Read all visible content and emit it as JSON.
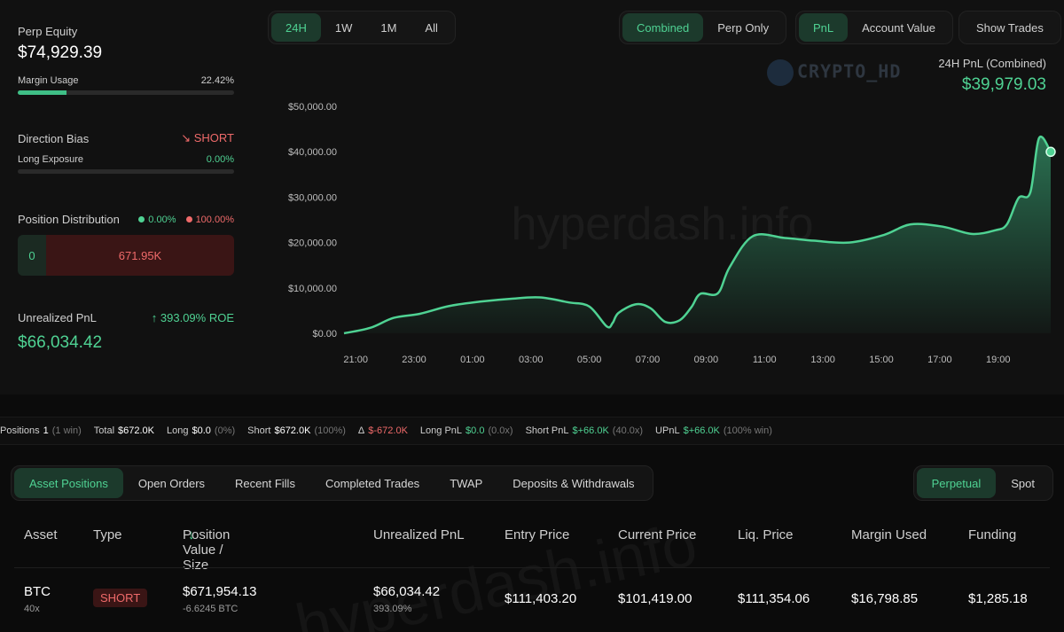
{
  "left": {
    "perp_equity": {
      "label": "Perp Equity",
      "value": "$74,929.39"
    },
    "margin_usage": {
      "label": "Margin Usage",
      "value": "22.42%",
      "fraction": 0.2242
    },
    "direction_bias": {
      "label": "Direction Bias",
      "value": "SHORT"
    },
    "long_exposure": {
      "label": "Long Exposure",
      "value": "0.00%",
      "fraction": 0
    },
    "position_distribution": {
      "label": "Position Distribution",
      "long_pct": "0.00%",
      "short_pct": "100.00%",
      "long_value": "0",
      "short_value": "671.95K"
    },
    "unrealized_pnl": {
      "label": "Unrealized PnL",
      "roe": "393.09% ROE",
      "value": "$66,034.42"
    }
  },
  "range_tabs": [
    "24H",
    "1W",
    "1M",
    "All"
  ],
  "range_active": "24H",
  "mode_tabs": [
    "Combined",
    "Perp Only"
  ],
  "metric_tabs": [
    "PnL",
    "Account Value"
  ],
  "show_trades_label": "Show Trades",
  "pnl_head": {
    "label": "24H PnL (Combined)",
    "value": "$39,979.03"
  },
  "watermark": {
    "brand": "CRYPTO_HD",
    "site": "hyperdash.info"
  },
  "colors": {
    "accent": "#4fd293",
    "negative": "#ef6a6a",
    "bg": "#111111"
  },
  "chart_data": {
    "type": "area",
    "title": "",
    "xlabel": "",
    "ylabel": "",
    "x_ticks": [
      "21:00",
      "23:00",
      "01:00",
      "03:00",
      "05:00",
      "07:00",
      "09:00",
      "11:00",
      "13:00",
      "15:00",
      "17:00",
      "19:00"
    ],
    "y_ticks": [
      "$0.00",
      "$10,000.00",
      "$20,000.00",
      "$30,000.00",
      "$40,000.00",
      "$50,000.00"
    ],
    "ylim": [
      0,
      50000
    ],
    "xlim_hours": [
      -0.4,
      23.8
    ],
    "series": [
      {
        "x": [
          -0.4,
          0.5,
          1.3,
          2.2,
          3.2,
          4.3,
          5.3,
          6.3,
          7.3,
          8.0,
          8.6,
          8.8,
          9.0,
          9.6,
          10.1,
          10.6,
          11.1,
          11.5,
          11.8,
          12.4,
          12.8,
          13.6,
          14.7,
          15.7,
          16.9,
          18.1,
          19.0,
          20.1,
          21.1,
          21.9,
          22.3,
          22.7,
          23.1,
          23.4,
          23.8
        ],
        "y": [
          0,
          1200,
          3400,
          4300,
          6000,
          7000,
          7600,
          7900,
          6800,
          5900,
          1500,
          2300,
          4500,
          6400,
          5500,
          2500,
          2900,
          5800,
          8700,
          8800,
          14500,
          21400,
          21000,
          20400,
          20000,
          21700,
          24000,
          23500,
          21900,
          22700,
          24000,
          29800,
          31000,
          43000,
          39979
        ]
      }
    ]
  },
  "strip": {
    "positions": {
      "label": "Positions",
      "value": "1",
      "note": "(1 win)"
    },
    "total": {
      "label": "Total",
      "value": "$672.0K"
    },
    "long": {
      "label": "Long",
      "value": "$0.0",
      "note": "(0%)"
    },
    "short": {
      "label": "Short",
      "value": "$672.0K",
      "note": "(100%)"
    },
    "delta": {
      "label": "Δ",
      "value": "$-672.0K"
    },
    "long_pnl": {
      "label": "Long PnL",
      "value": "$0.0",
      "note": "(0.0x)"
    },
    "short_pnl": {
      "label": "Short PnL",
      "value": "$+66.0K",
      "note": "(40.0x)"
    },
    "upnl": {
      "label": "UPnL",
      "value": "$+66.0K",
      "note": "(100% win)"
    }
  },
  "tabs": [
    "Asset Positions",
    "Open Orders",
    "Recent Fills",
    "Completed Trades",
    "TWAP",
    "Deposits & Withdrawals"
  ],
  "market_toggle": [
    "Perpetual",
    "Spot"
  ],
  "table": {
    "headers": [
      "Asset",
      "Type",
      "Position Value / Size",
      "Unrealized PnL",
      "Entry Price",
      "Current Price",
      "Liq. Price",
      "Margin Used",
      "Funding"
    ],
    "sort_icon": "arrow-down-icon",
    "row": {
      "asset": "BTC",
      "leverage": "40x",
      "type": "SHORT",
      "position_value": "$671,954.13",
      "size": "-6.6245 BTC",
      "upnl": "$66,034.42",
      "upnl_pct": "393.09%",
      "entry": "$111,403.20",
      "current": "$101,419.00",
      "liq": "$111,354.06",
      "margin": "$16,798.85",
      "funding": "$1,285.18"
    }
  }
}
